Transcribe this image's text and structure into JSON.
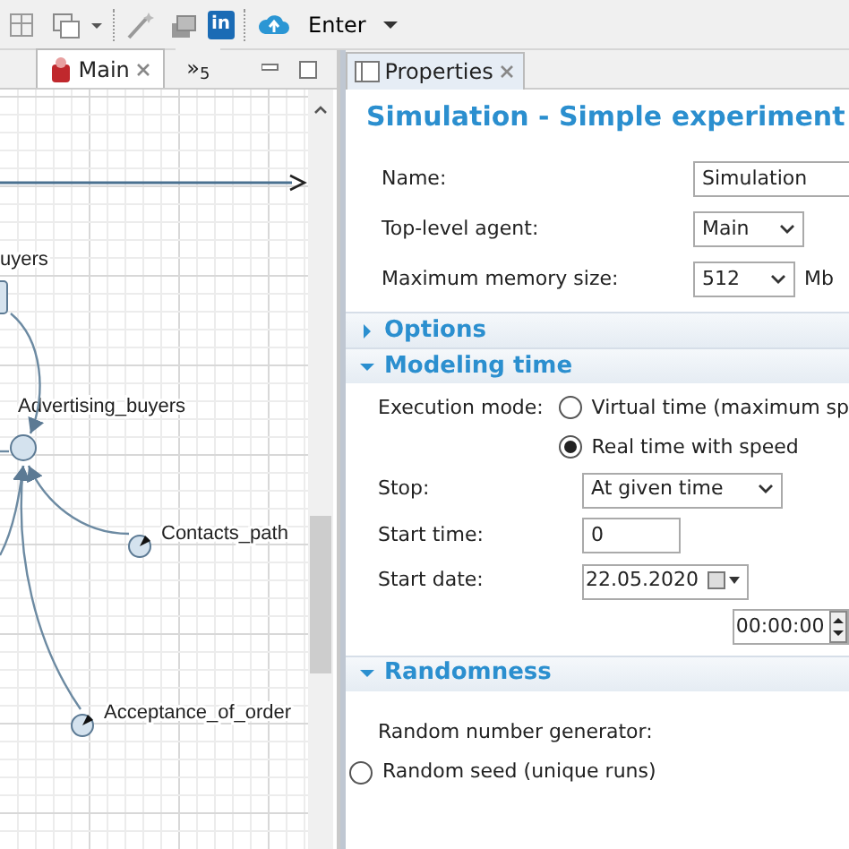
{
  "toolbar": {
    "logo_text": "in",
    "menu_label": "Enter"
  },
  "editor": {
    "tabs": [
      {
        "label": "Main",
        "selected": true,
        "kind": "agent"
      },
      {
        "label": "»$_{5}$",
        "selected": false,
        "kind": "overflow"
      }
    ],
    "diagram": {
      "nodes": [
        {
          "label": "uyers",
          "kind": "state"
        },
        {
          "label": "Advertising_buyers",
          "kind": "branch"
        },
        {
          "label": "Contacts_path",
          "kind": "pointer"
        },
        {
          "label": "Acceptance_of_order",
          "kind": "pointer"
        }
      ]
    }
  },
  "properties": {
    "tab": {
      "label": "Properties"
    },
    "title": "Simulation - Simple experiment",
    "fields": [
      {
        "label": "Name:",
        "kind": "text",
        "value": "Simulation"
      },
      {
        "label": "Top-level agent:",
        "kind": "select",
        "value": "Main"
      },
      {
        "label": "Maximum memory size:",
        "kind": "select",
        "value": "512",
        "unit": "Mb"
      }
    ],
    "sections": [
      {
        "title": "Options",
        "expanded": false
      },
      {
        "title": "Modeling time",
        "expanded": true,
        "rows": [
          {
            "kind": "radio",
            "label": "Execution mode:",
            "options": [
              {
                "label": "Virtual time (maximum sp",
                "selected": false
              },
              {
                "label": "Real time with speed",
                "selected": true
              }
            ]
          },
          {
            "kind": "select",
            "label": "Stop:",
            "value": "At given time"
          },
          {
            "kind": "text",
            "label": "Start time:",
            "value": "0"
          },
          {
            "kind": "date",
            "label": "Start date:",
            "value": "22.05.2020"
          },
          {
            "kind": "spin",
            "value": "00:00:00"
          }
        ]
      },
      {
        "title": "Randomness",
        "expanded": true,
        "rows": [
          {
            "kind": "heading",
            "label": "Random number generator:"
          },
          {
            "kind": "radio",
            "options": [
              {
                "label": "Random seed (unique runs)",
                "selected": false
              }
            ]
          }
        ]
      }
    ]
  }
}
